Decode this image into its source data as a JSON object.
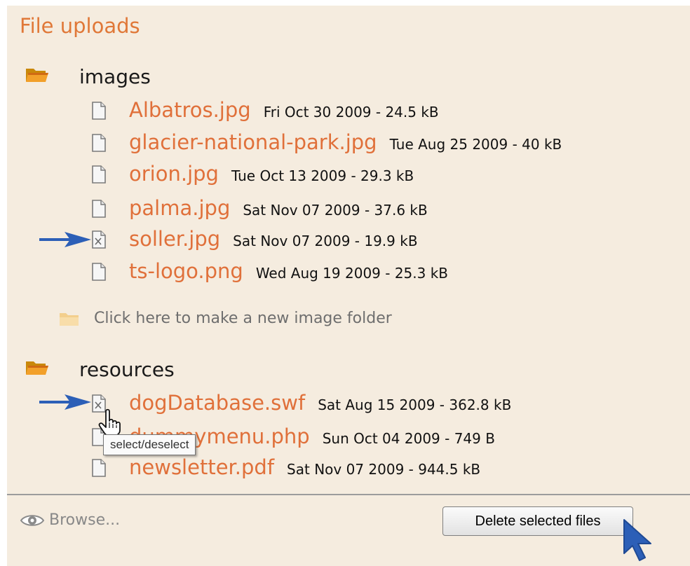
{
  "title": "File uploads",
  "folders": [
    {
      "name": "images",
      "files": [
        {
          "name": "Albatros.jpg",
          "meta": "Fri Oct 30 2009 - 24.5 kB",
          "selected": false
        },
        {
          "name": "glacier-national-park.jpg",
          "meta": "Tue Aug 25 2009 - 40 kB",
          "selected": false
        },
        {
          "name": "orion.jpg",
          "meta": "Tue Oct 13 2009 - 29.3 kB",
          "selected": false
        },
        {
          "name": "palma.jpg",
          "meta": "Sat Nov 07 2009 - 37.6 kB",
          "selected": false
        },
        {
          "name": "soller.jpg",
          "meta": "Sat Nov 07 2009 - 19.9 kB",
          "selected": true
        },
        {
          "name": "ts-logo.png",
          "meta": "Wed Aug 19 2009 - 25.3 kB",
          "selected": false
        }
      ],
      "new_folder_label": "Click here to make a new image folder"
    },
    {
      "name": "resources",
      "files": [
        {
          "name": "dogDatabase.swf",
          "meta": "Sat Aug 15 2009 - 362.8 kB",
          "selected": true
        },
        {
          "name": "dummymenu.php",
          "meta": "Sun Oct 04 2009 - 749 B",
          "selected": false
        },
        {
          "name": "newsletter.pdf",
          "meta": "Sat Nov 07 2009 - 944.5 kB",
          "selected": false
        }
      ]
    }
  ],
  "tooltip": "select/deselect",
  "browse_label": "Browse...",
  "delete_label": "Delete selected files",
  "colors": {
    "panel_bg": "#f5ecdf",
    "accent": "#e07838",
    "arrow": "#2c5fb7"
  },
  "icons": {
    "folder": "folder-open-icon",
    "file": "file-icon",
    "file_selected": "file-selected-icon",
    "eye": "eye-icon",
    "cursor": "mouse-pointer-icon",
    "hand": "hand-pointer-icon"
  }
}
